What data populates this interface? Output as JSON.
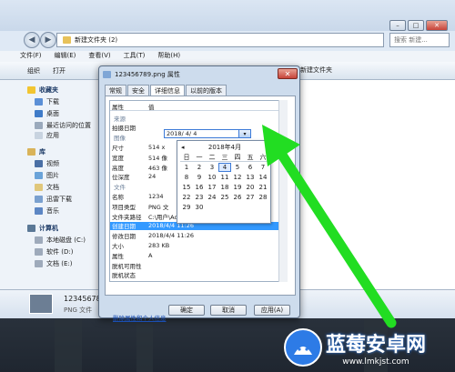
{
  "explorer": {
    "address": "新建文件夹 (2)",
    "search_placeholder": "搜索 新建...",
    "menu": [
      "文件(F)",
      "编辑(E)",
      "查看(V)",
      "工具(T)",
      "帮助(H)"
    ],
    "toolbar": {
      "organize": "组织",
      "open": "打开"
    },
    "column_header": "新建文件夹",
    "nav": {
      "favorites": "收藏夹",
      "favorites_items": [
        "下载",
        "桌面",
        "最近访问的位置"
      ],
      "extra_item": "应用",
      "libraries": "库",
      "library_items": [
        "视频",
        "图片",
        "文档",
        "迅雷下载",
        "音乐"
      ],
      "computer": "计算机",
      "computer_items": [
        "本地磁盘 (C:)",
        "软件 (D:)",
        "文档 (E:)"
      ]
    },
    "details": {
      "filename": "12345678",
      "filetype": "PNG 文件"
    }
  },
  "dialog": {
    "title": "123456789.png 属性",
    "close_glyph": "✕",
    "tabs": [
      "常规",
      "安全",
      "详细信息",
      "以前的版本"
    ],
    "active_tab": 2,
    "table_header": {
      "property": "属性",
      "value": "值"
    },
    "rows": [
      {
        "k": "来源",
        "v": "",
        "section": true
      },
      {
        "k": "拍摄日期",
        "v": "",
        "section": false
      },
      {
        "k": "图像",
        "v": "",
        "section": true
      },
      {
        "k": "尺寸",
        "v": "514 x",
        "section": false
      },
      {
        "k": "宽度",
        "v": "514 像",
        "section": false
      },
      {
        "k": "高度",
        "v": "463 像",
        "section": false
      },
      {
        "k": "位深度",
        "v": "24",
        "section": false
      },
      {
        "k": "文件",
        "v": "",
        "section": true
      },
      {
        "k": "名称",
        "v": "1234",
        "section": false
      },
      {
        "k": "项目类型",
        "v": "PNG 文",
        "section": false
      },
      {
        "k": "文件夹路径",
        "v": "C:\\用户\\Administrator\\桌面\\新",
        "section": false
      },
      {
        "k": "创建日期",
        "v": "2018/4/4 11:26",
        "section": false,
        "selected": true
      },
      {
        "k": "修改日期",
        "v": "2018/4/4 11:26",
        "section": false
      },
      {
        "k": "大小",
        "v": "283 KB",
        "section": false
      },
      {
        "k": "属性",
        "v": "A",
        "section": false
      },
      {
        "k": "脱机可用性",
        "v": "",
        "section": false
      },
      {
        "k": "脱机状态",
        "v": "",
        "section": false
      }
    ],
    "date_value": "2018/ 4/ 4",
    "remove_link": "删除属性和个人信息",
    "ok": "确定",
    "cancel": "取消",
    "apply": "应用(A)"
  },
  "calendar": {
    "title": "2018年4月",
    "prev": "◂",
    "next": "▸",
    "weekdays": [
      "日",
      "一",
      "二",
      "三",
      "四",
      "五",
      "六"
    ],
    "days": [
      "1",
      "2",
      "3",
      "4",
      "5",
      "6",
      "7",
      "8",
      "9",
      "10",
      "11",
      "12",
      "13",
      "14",
      "15",
      "16",
      "17",
      "18",
      "19",
      "20",
      "21",
      "22",
      "23",
      "24",
      "25",
      "26",
      "27",
      "28",
      "29",
      "30"
    ],
    "today": "4"
  },
  "watermark": {
    "name": "蓝莓安卓网",
    "url": "www.lmkjst.com"
  },
  "colors": {
    "accent": "#3399ff",
    "arrow": "#22dd22",
    "brand": "#2d7be6"
  }
}
